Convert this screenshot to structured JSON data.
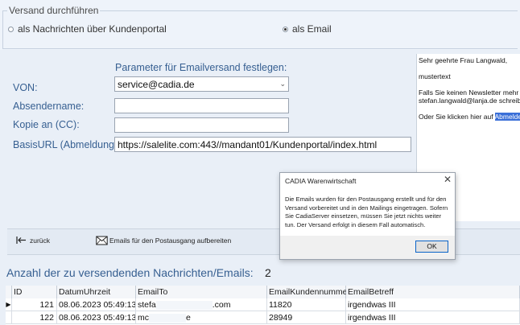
{
  "versand": {
    "title": "Versand durchführen",
    "option_portal": "als Nachrichten über Kundenportal",
    "option_email": "als Email",
    "selected": "email"
  },
  "params": {
    "title": "Parameter für Emailversand festlegen:",
    "von_label": "VON:",
    "von_value": "service@cadia.de",
    "absender_label": "Absendername:",
    "absender_value": "",
    "cc_label": "Kopie an (CC):",
    "cc_value": "",
    "basisurl_label": "BasisURL (Abmeldung):",
    "basisurl_value": "https://salelite.com:443//mandant01/Kundenportal/index.html"
  },
  "preview": {
    "line1": "Sehr geehrte Frau Langwald,",
    "line2": "mustertext",
    "line3a": "Falls Sie keinen Newsletter mehr w",
    "line3b": "stefan.langwald@lanja.de schreibe",
    "line4a": "Oder Sie klicken hier auf ",
    "line4b": "Abmelden"
  },
  "toolbar": {
    "back_label": "zurück",
    "prepare_label": "Emails für den Postausgang aufbereiten"
  },
  "summary": {
    "count_label": "Anzahl der zu versendenden Nachrichten/Emails:",
    "count_value": "2"
  },
  "grid": {
    "columns": [
      "ID",
      "DatumUhrzeit",
      "EmailTo",
      "EmailKundennummer",
      "EmailBetreff"
    ],
    "rows": [
      {
        "id": "121",
        "datum": "08.06.2023 05:49:13",
        "email_start": "stefa",
        "email_end": ".com",
        "kundennummer": "11820",
        "betreff": "irgendwas III"
      },
      {
        "id": "122",
        "datum": "08.06.2023 05:49:13",
        "email_start": "mc",
        "email_end": "e",
        "kundennummer": "28949",
        "betreff": "irgendwas III"
      }
    ]
  },
  "dialog": {
    "title": "CADIA Warenwirtschaft",
    "message": "Die Emails wurden für den Postausgang erstellt und für den Versand vorbereitet und in den Mailings eingetragen. Sofern Sie CadiaServer einsetzen, müssen Sie jetzt nichts weiter tun. Der Versand erfolgt in diesem Fall automatisch.",
    "ok_label": "OK"
  }
}
